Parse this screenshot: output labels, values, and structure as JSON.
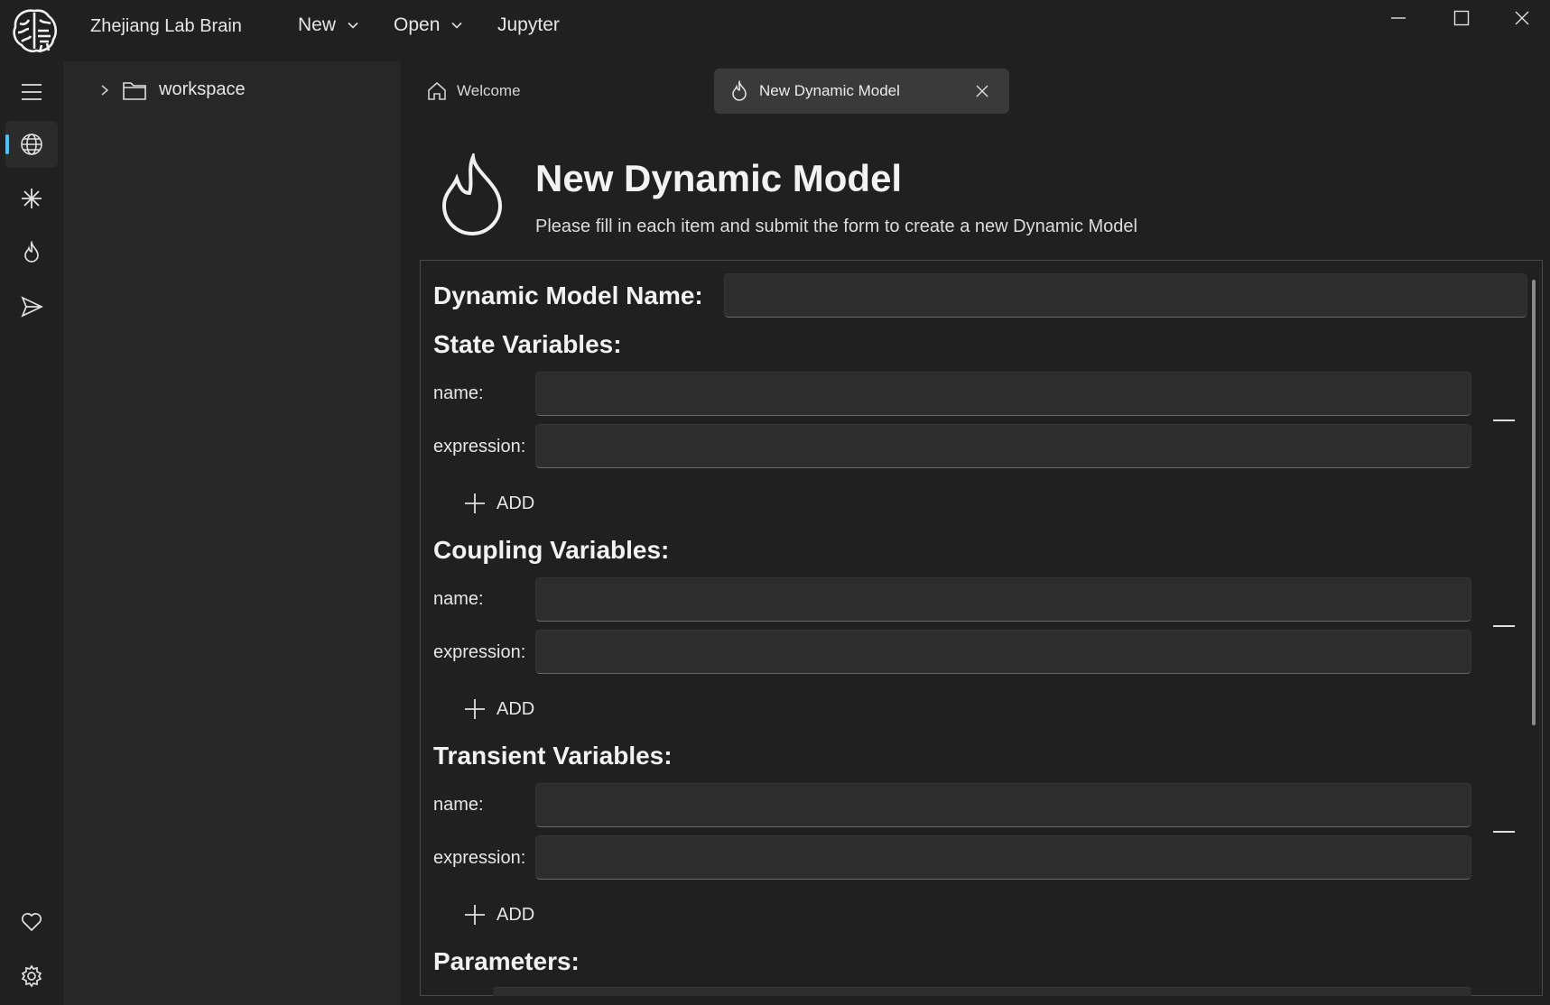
{
  "app": {
    "title": "Zhejiang Lab Brain"
  },
  "menubar": {
    "new_label": "New",
    "open_label": "Open",
    "jupyter_label": "Jupyter"
  },
  "explorer": {
    "root_folder": "workspace"
  },
  "tabs": [
    {
      "label": "Welcome",
      "icon": "home-icon"
    },
    {
      "label": "New Dynamic Model",
      "icon": "flame-icon",
      "active": true
    }
  ],
  "page": {
    "title": "New Dynamic Model",
    "subtitle": "Please fill in each item and submit the form to create a new Dynamic Model"
  },
  "form": {
    "model_name_label": "Dynamic Model Name:",
    "model_name_value": "",
    "sections": [
      {
        "title": "State Variables:",
        "name_label": "name:",
        "expression_label": "expression:",
        "add_label": "ADD"
      },
      {
        "title": "Coupling Variables:",
        "name_label": "name:",
        "expression_label": "expression:",
        "add_label": "ADD"
      },
      {
        "title": "Transient Variables:",
        "name_label": "name:",
        "expression_label": "expression:",
        "add_label": "ADD"
      }
    ],
    "parameters_title": "Parameters:"
  },
  "colors": {
    "accent": "#4cc2ff",
    "background": "#202020",
    "panel": "#272727",
    "input": "#2d2d2d"
  }
}
